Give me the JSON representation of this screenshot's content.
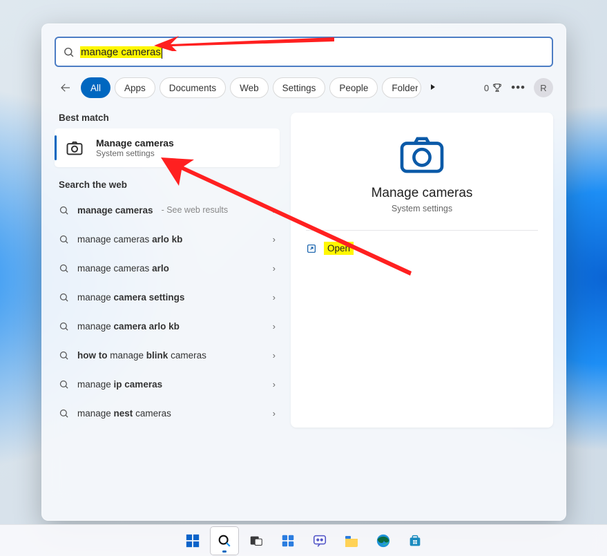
{
  "search": {
    "query": "manage cameras"
  },
  "filters": {
    "tabs": [
      "All",
      "Apps",
      "Documents",
      "Web",
      "Settings",
      "People",
      "Folders"
    ],
    "active_index": 0
  },
  "toolbar": {
    "rewards_count": "0",
    "avatar_letter": "R"
  },
  "left": {
    "best_label": "Best match",
    "best": {
      "title": "Manage cameras",
      "subtitle": "System settings"
    },
    "web_label": "Search the web",
    "web": [
      {
        "pre": "",
        "bold": "manage cameras",
        "post": "",
        "hint": " - See web results"
      },
      {
        "pre": "manage cameras ",
        "bold": "arlo kb",
        "post": "",
        "hint": ""
      },
      {
        "pre": "manage cameras ",
        "bold": "arlo",
        "post": "",
        "hint": ""
      },
      {
        "pre": "manage ",
        "bold": "camera settings",
        "post": "",
        "hint": ""
      },
      {
        "pre": "manage ",
        "bold": "camera arlo kb",
        "post": "",
        "hint": ""
      },
      {
        "pre": "",
        "bold": "how to",
        "post": " manage ",
        "bold2": "blink",
        "post2": " cameras",
        "hint": ""
      },
      {
        "pre": "manage ",
        "bold": "ip cameras",
        "post": "",
        "hint": ""
      },
      {
        "pre": "manage ",
        "bold": "nest",
        "post": " cameras",
        "hint": ""
      }
    ]
  },
  "preview": {
    "title": "Manage cameras",
    "subtitle": "System settings",
    "open_label": "Open"
  },
  "colors": {
    "accent": "#0067c0",
    "highlight": "#fff700",
    "annotation": "#ff2020"
  }
}
